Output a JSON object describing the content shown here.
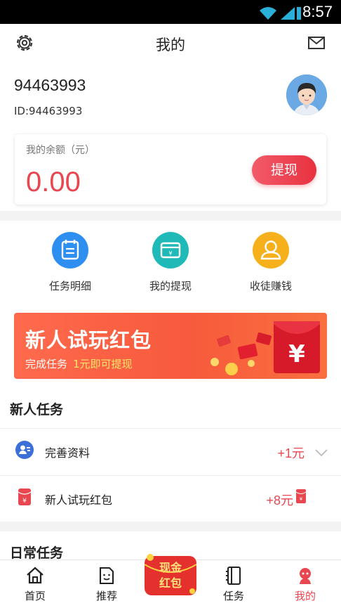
{
  "status_bar": {
    "time": "8:57"
  },
  "header": {
    "title": "我的",
    "settings_icon": "gear-icon",
    "message_icon": "envelope-icon"
  },
  "profile": {
    "username": "94463993",
    "user_id": "ID:94463993"
  },
  "balance": {
    "label": "我的余额（元）",
    "value": "0.00",
    "withdraw_label": "提现"
  },
  "shortcuts": [
    {
      "label": "任务明细",
      "icon": "task-list-icon",
      "color": "#2f8ff0"
    },
    {
      "label": "我的提现",
      "icon": "wallet-card-icon",
      "color": "#1fbab7"
    },
    {
      "label": "收徒赚钱",
      "icon": "user-icon",
      "color": "#f6b01c"
    }
  ],
  "banner": {
    "title": "新人试玩红包",
    "subtitle": "完成任务",
    "highlight": "1元即可提现"
  },
  "new_tasks": {
    "title": "新人任务",
    "items": [
      {
        "label": "完善资料",
        "reward": "+1元",
        "icon": "profile-icon"
      },
      {
        "label": "新人试玩红包",
        "reward": "+8元",
        "icon": "red-envelope-icon"
      }
    ]
  },
  "daily_tasks": {
    "title": "日常任务"
  },
  "tabbar": {
    "tabs": [
      {
        "label": "首页",
        "icon": "home-icon"
      },
      {
        "label": "推荐",
        "icon": "smile-doc-icon"
      },
      {
        "label": "任务",
        "icon": "notebook-icon"
      },
      {
        "label": "我的",
        "icon": "person-icon",
        "active": true
      }
    ],
    "center_badge": {
      "line1": "现金",
      "line2": "红包"
    }
  },
  "colors": {
    "accent": "#e8474f",
    "banner": "#f75a3c"
  }
}
